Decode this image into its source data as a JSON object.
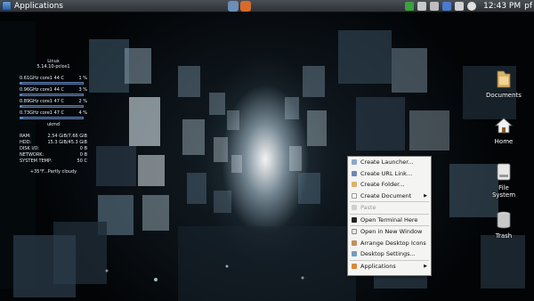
{
  "panel": {
    "apps_label": "Applications",
    "clock": "12:43 PM",
    "user": "pf"
  },
  "conky": {
    "os": "Linux",
    "kernel": "5.14.10-pclos1",
    "cpus": [
      {
        "label": "0.61GHz  core1  44 C",
        "pct": "1 %",
        "fill": 0.01
      },
      {
        "label": "0.96GHz  core1  44 C",
        "pct": "3 %",
        "fill": 0.03
      },
      {
        "label": "0.89GHz  core1  47 C",
        "pct": "2 %",
        "fill": 0.02
      },
      {
        "label": "0.73GHz  core1  47 C",
        "pct": "4 %",
        "fill": 0.04
      }
    ],
    "process": "ukmd",
    "stats": [
      {
        "name": "RAM:",
        "value": "2.54 GiB/7.66 GiB"
      },
      {
        "name": "HDD:",
        "value": "15.3 GiB/45.3 GiB"
      },
      {
        "name": "DISK I/O:",
        "value": "0 B"
      },
      {
        "name": "NETWORK:",
        "value": "0 B"
      },
      {
        "name": "SYSTEM TEMP:",
        "value": "50 C"
      }
    ],
    "weather": "+35°F...Partly cloudy"
  },
  "desktop_icons": [
    {
      "label": "Documents",
      "icon": "folder-icon"
    },
    {
      "label": "Home",
      "icon": "home-icon"
    },
    {
      "label": "File System",
      "icon": "drive-icon"
    },
    {
      "label": "Trash",
      "icon": "trash-icon"
    }
  ],
  "context_menu": {
    "items": [
      {
        "label": "Create Launcher...",
        "icon": "launcher-icon"
      },
      {
        "label": "Create URL Link...",
        "icon": "link-icon"
      },
      {
        "label": "Create Folder...",
        "icon": "folder-icon"
      },
      {
        "label": "Create Document",
        "icon": "document-icon",
        "submenu": true
      },
      {
        "label": "Paste",
        "icon": "paste-icon",
        "disabled": true
      },
      {
        "label": "Open Terminal Here",
        "icon": "terminal-icon"
      },
      {
        "label": "Open in New Window",
        "icon": "window-icon"
      },
      {
        "label": "Arrange Desktop Icons",
        "icon": "arrange-icon"
      },
      {
        "label": "Desktop Settings...",
        "icon": "settings-icon"
      },
      {
        "label": "Applications",
        "icon": "applications-icon",
        "submenu": true
      }
    ]
  },
  "colors": {
    "accent": "#4a90e0",
    "panel": "#3a3e43",
    "menu_bg": "#f4f4f2"
  }
}
